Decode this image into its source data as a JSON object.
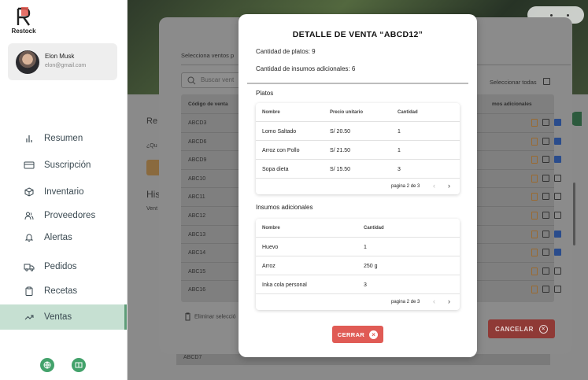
{
  "colors": {
    "accent": "#43a26b",
    "active_bg": "#c6e0d2",
    "danger": "#e05b55"
  },
  "app": {
    "name": "Restock"
  },
  "user": {
    "name": "Elon Musk",
    "email": "elon@gmail.com"
  },
  "sidebar": {
    "items": [
      {
        "label": "Resumen",
        "icon": "bar-chart-icon"
      },
      {
        "label": "Suscripción",
        "icon": "credit-card-icon"
      },
      {
        "label": "Inventario",
        "icon": "cube-icon"
      },
      {
        "label": "Proveedores",
        "icon": "users-icon"
      },
      {
        "label": "Alertas",
        "icon": "bell-icon"
      },
      {
        "label": "Pedidos",
        "icon": "truck-icon"
      },
      {
        "label": "Recetas",
        "icon": "clipboard-icon"
      },
      {
        "label": "Ventas",
        "icon": "trending-up-icon"
      }
    ]
  },
  "background": {
    "section_prefix": "Re",
    "question_prefix": "¿Qu",
    "history_prefix": "His",
    "sales_prefix": "Vent",
    "bg_row_code": "ABCD7"
  },
  "sales_modal": {
    "select_prompt": "Selecciona ventos p",
    "search_placeholder": "Buscar vent",
    "select_all": "Seleccionar todas",
    "col_code": "Código de venta",
    "col_extras": "mos adicionales",
    "rows": [
      "ABCD3",
      "ABCD6",
      "ABCD9",
      "ABC10",
      "ABC11",
      "ABC12",
      "ABC13",
      "ABC14",
      "ABC15",
      "ABC16"
    ],
    "checked": [
      true,
      true,
      true,
      false,
      false,
      false,
      true,
      true,
      false,
      false
    ],
    "delete_label": "Eliminar selecció",
    "cancel_label": "CANCELAR"
  },
  "detail": {
    "title": "DETALLE DE VENTA “ABCD12”",
    "dish_count": "Cantidad de platos: 9",
    "extras_count": "Cantidad de insumos adicionales: 6",
    "dishes_label": "Platos",
    "dishes_headers": {
      "name": "Nombre",
      "price": "Precio unitario",
      "qty": "Cantidad"
    },
    "dishes": [
      {
        "name": "Lomo Saltado",
        "price": "S/ 20.50",
        "qty": "1"
      },
      {
        "name": "Arroz con Pollo",
        "price": "S/ 21.50",
        "qty": "1"
      },
      {
        "name": "Sopa dieta",
        "price": "S/ 15.50",
        "qty": "3"
      }
    ],
    "dishes_page": "pagina 2 de 3",
    "extras_label": "Insumos adicionales",
    "extras_headers": {
      "name": "Nombre",
      "qty": "Cantidad"
    },
    "extras": [
      {
        "name": "Huevo",
        "qty": "1"
      },
      {
        "name": "Arroz",
        "qty": "250 g"
      },
      {
        "name": "Inka cola personal",
        "qty": "3"
      }
    ],
    "extras_page": "pagina 2 de 3",
    "close_label": "CERRAR"
  }
}
